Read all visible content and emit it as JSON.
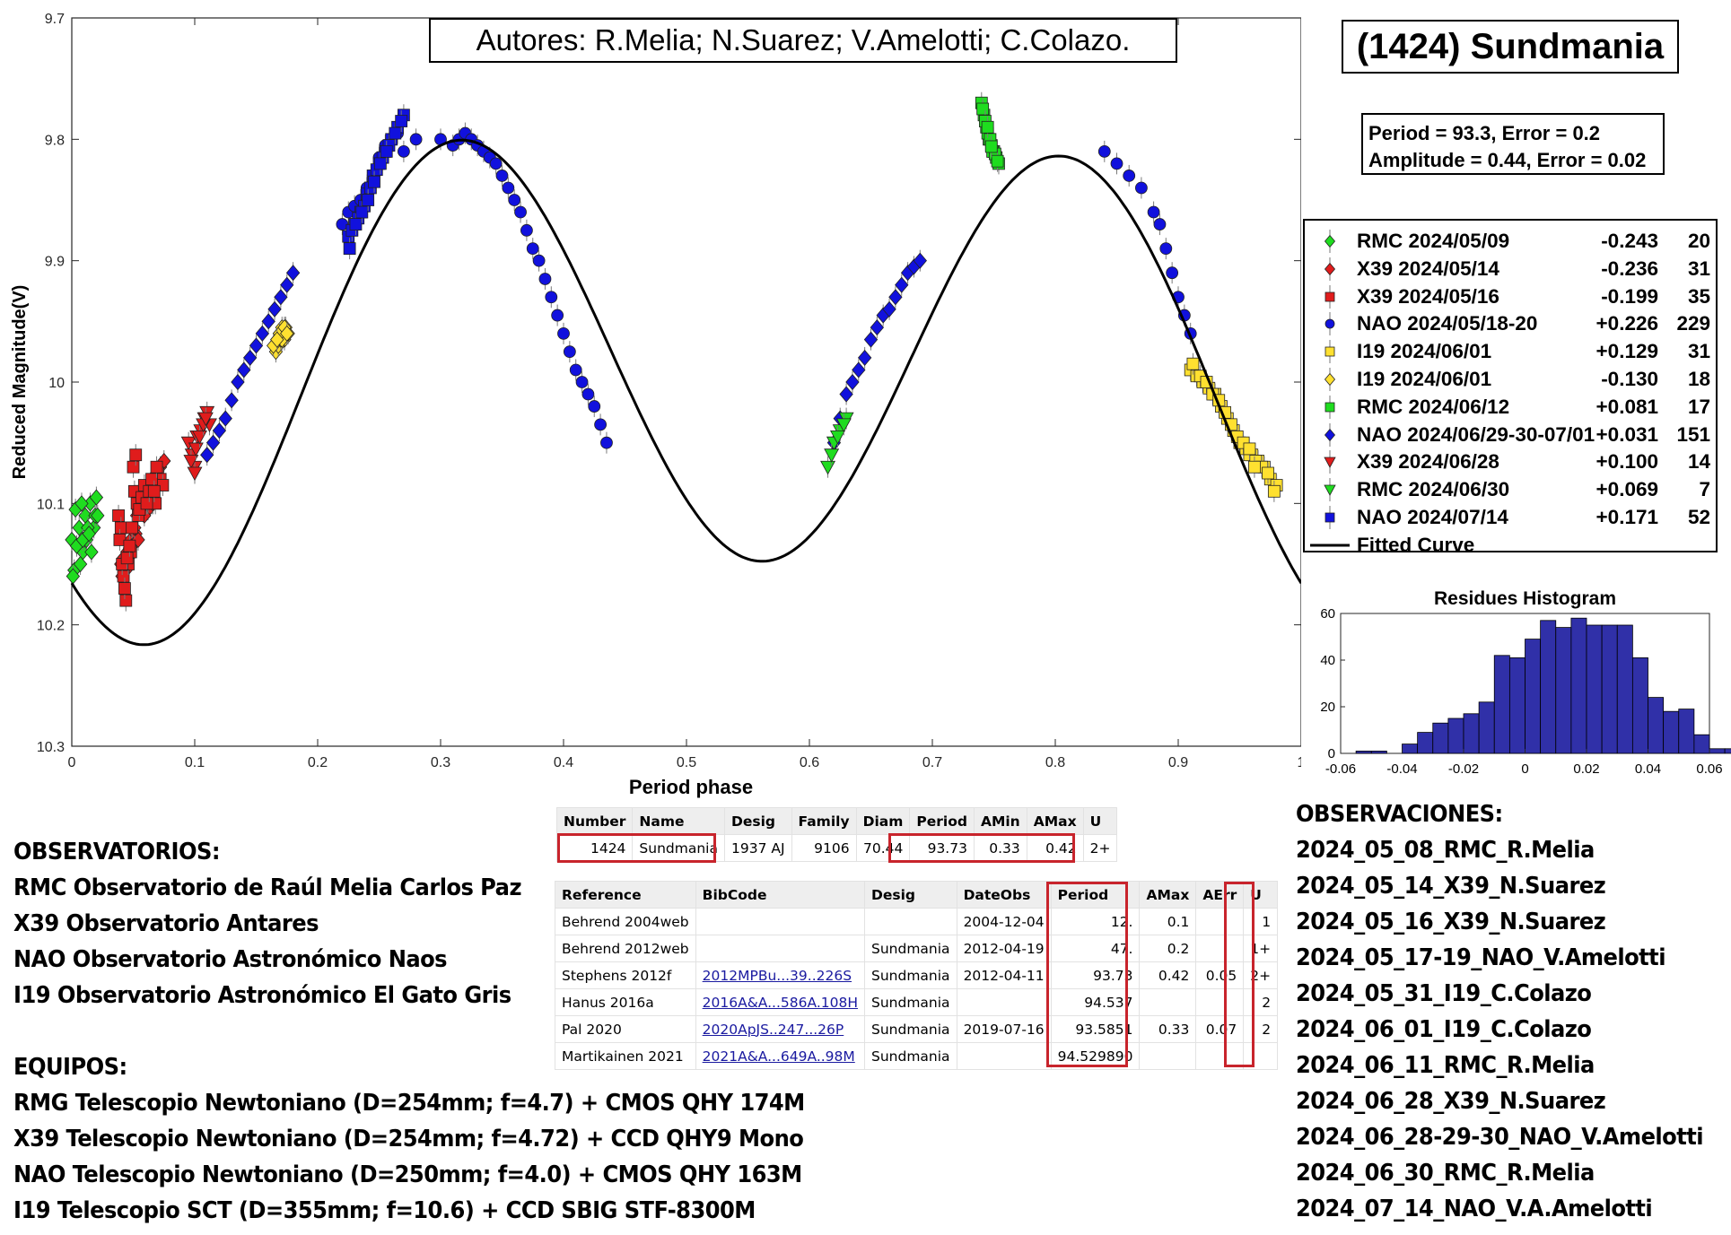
{
  "authors": "Autores: R.Melia; N.Suarez; V.Amelotti; C.Colazo.",
  "object_title": "(1424) Sundmania",
  "fit": {
    "period_line": "Period =  93.3, Error = 0.2",
    "amplitude_line": "Amplitude = 0.44, Error = 0.02"
  },
  "chart_data": [
    {
      "type": "scatter",
      "title": "",
      "xlabel": "Period phase",
      "ylabel": "Reduced Magnitude(V)",
      "xlim": [
        0,
        1
      ],
      "ylim": [
        10.3,
        9.7
      ],
      "y_inverted": true,
      "xticks": [
        "0",
        "0.1",
        "0.2",
        "0.3",
        "0.4",
        "0.5",
        "0.6",
        "0.7",
        "0.8",
        "0.9",
        "1"
      ],
      "yticks": [
        "9.7",
        "9.8",
        "9.9",
        "10",
        "10.1",
        "10.2",
        "10.3"
      ],
      "series": [
        {
          "name": "RMC 2024/05/09",
          "offset": "-0.243",
          "n": "20",
          "color": "#1fdc1f",
          "marker": "diamond",
          "x": [
            0.0,
            0.003,
            0.006,
            0.009,
            0.012,
            0.015,
            0.018,
            0.02,
            0.002,
            0.007,
            0.011,
            0.016,
            0.004,
            0.013,
            0.009,
            0.019,
            0.001,
            0.008,
            0.014,
            0.021
          ],
          "y": [
            10.13,
            10.105,
            10.12,
            10.14,
            10.13,
            10.1,
            10.12,
            10.095,
            10.155,
            10.15,
            10.11,
            10.14,
            10.135,
            10.12,
            10.13,
            10.11,
            10.16,
            10.1,
            10.125,
            10.11
          ]
        },
        {
          "name": "X39 2024/05/14",
          "offset": "-0.236",
          "n": "31",
          "color": "#e01c1c",
          "marker": "diamond",
          "x": [
            0.04,
            0.042,
            0.045,
            0.048,
            0.05,
            0.053,
            0.055,
            0.058,
            0.06,
            0.063,
            0.065,
            0.068,
            0.07,
            0.043,
            0.047,
            0.052,
            0.057,
            0.062,
            0.066,
            0.072,
            0.075,
            0.044,
            0.049,
            0.054,
            0.059,
            0.064,
            0.069,
            0.041,
            0.046,
            0.051,
            0.061
          ],
          "y": [
            10.15,
            10.145,
            10.14,
            10.13,
            10.12,
            10.11,
            10.1,
            10.105,
            10.1,
            10.09,
            10.1,
            10.085,
            10.08,
            10.15,
            10.14,
            10.125,
            10.095,
            10.105,
            10.1,
            10.07,
            10.065,
            10.155,
            10.135,
            10.13,
            10.11,
            10.09,
            10.075,
            10.16,
            10.145,
            10.12,
            10.1
          ]
        },
        {
          "name": "X39 2024/05/16",
          "offset": "-0.199",
          "n": "35",
          "color": "#e01c1c",
          "marker": "square",
          "x": [
            0.038,
            0.04,
            0.042,
            0.044,
            0.046,
            0.048,
            0.05,
            0.052,
            0.054,
            0.056,
            0.058,
            0.06,
            0.062,
            0.064,
            0.066,
            0.068,
            0.07,
            0.072,
            0.074,
            0.039,
            0.041,
            0.043,
            0.045,
            0.047,
            0.049,
            0.051,
            0.053,
            0.055,
            0.057,
            0.059,
            0.061,
            0.063,
            0.065,
            0.067,
            0.069
          ],
          "y": [
            10.11,
            10.12,
            10.16,
            10.18,
            10.15,
            10.14,
            10.07,
            10.06,
            10.11,
            10.09,
            10.1,
            10.09,
            10.1,
            10.095,
            10.085,
            10.1,
            10.075,
            10.08,
            10.085,
            10.13,
            10.15,
            10.17,
            10.145,
            10.135,
            10.12,
            10.09,
            10.1,
            10.105,
            10.095,
            10.085,
            10.1,
            10.09,
            10.08,
            10.09,
            10.07
          ]
        },
        {
          "name": "NAO 2024/05/18-20",
          "offset": "+0.226",
          "n": "229",
          "color": "#1111dd",
          "marker": "circle",
          "x": [
            0.27,
            0.28,
            0.3,
            0.31,
            0.315,
            0.32,
            0.325,
            0.33,
            0.335,
            0.34,
            0.345,
            0.35,
            0.355,
            0.36,
            0.365,
            0.37,
            0.375,
            0.38,
            0.385,
            0.39,
            0.395,
            0.4,
            0.405,
            0.41,
            0.415,
            0.42,
            0.425,
            0.43,
            0.435,
            0.22,
            0.225,
            0.23,
            0.235,
            0.24,
            0.245,
            0.25,
            0.255,
            0.26,
            0.265,
            0.84,
            0.85,
            0.86,
            0.87,
            0.88,
            0.885,
            0.89,
            0.895,
            0.9,
            0.905,
            0.91
          ],
          "y": [
            9.81,
            9.8,
            9.8,
            9.805,
            9.8,
            9.795,
            9.8,
            9.805,
            9.81,
            9.815,
            9.82,
            9.83,
            9.84,
            9.85,
            9.86,
            9.875,
            9.89,
            9.9,
            9.915,
            9.93,
            9.945,
            9.96,
            9.975,
            9.99,
            10.0,
            10.01,
            10.02,
            10.035,
            10.05,
            9.87,
            9.86,
            9.855,
            9.85,
            9.84,
            9.83,
            9.815,
            9.805,
            9.8,
            9.795,
            9.81,
            9.82,
            9.83,
            9.84,
            9.86,
            9.87,
            9.89,
            9.91,
            9.93,
            9.945,
            9.96
          ]
        },
        {
          "name": "I19 2024/06/01",
          "offset": "+0.129",
          "n": "31",
          "color": "#ffe030",
          "marker": "square",
          "x": [
            0.91,
            0.915,
            0.92,
            0.925,
            0.93,
            0.935,
            0.94,
            0.945,
            0.95,
            0.955,
            0.96,
            0.965,
            0.97,
            0.975,
            0.98,
            0.912,
            0.918,
            0.923,
            0.928,
            0.933,
            0.938,
            0.943,
            0.948,
            0.953,
            0.958,
            0.963,
            0.968,
            0.973,
            0.978,
            0.958,
            0.962
          ],
          "y": [
            9.99,
            9.995,
            10.0,
            10.005,
            10.01,
            10.02,
            10.03,
            10.04,
            10.05,
            10.055,
            10.06,
            10.065,
            10.07,
            10.08,
            10.085,
            9.985,
            9.995,
            10.0,
            10.01,
            10.015,
            10.025,
            10.035,
            10.045,
            10.05,
            10.06,
            10.065,
            10.07,
            10.075,
            10.09,
            10.055,
            10.07
          ]
        },
        {
          "name": "I19 2024/06/01",
          "offset": "-0.130",
          "n": "18",
          "color": "#ffe030",
          "marker": "diamond",
          "x": [
            0.165,
            0.167,
            0.169,
            0.171,
            0.173,
            0.175,
            0.166,
            0.168,
            0.17,
            0.172,
            0.174,
            0.176,
            0.164,
            0.171,
            0.169,
            0.173,
            0.167,
            0.175
          ],
          "y": [
            9.97,
            9.965,
            9.96,
            9.955,
            9.965,
            9.96,
            9.975,
            9.97,
            9.965,
            9.96,
            9.955,
            9.96,
            9.97,
            9.965,
            9.96,
            9.955,
            9.965,
            9.96
          ]
        },
        {
          "name": "RMC 2024/06/12",
          "offset": "+0.081",
          "n": "17",
          "color": "#1fdc1f",
          "marker": "square",
          "x": [
            0.74,
            0.742,
            0.744,
            0.746,
            0.748,
            0.75,
            0.752,
            0.754,
            0.741,
            0.743,
            0.745,
            0.747,
            0.749,
            0.751,
            0.753,
            0.745,
            0.748
          ],
          "y": [
            9.77,
            9.78,
            9.79,
            9.8,
            9.805,
            9.81,
            9.815,
            9.82,
            9.775,
            9.785,
            9.795,
            9.8,
            9.81,
            9.812,
            9.818,
            9.79,
            9.806
          ]
        },
        {
          "name": "NAO 2024/06/29-30-07/01",
          "offset": "+0.031",
          "n": "151",
          "color": "#1111dd",
          "marker": "diamond",
          "x": [
            0.12,
            0.125,
            0.13,
            0.135,
            0.14,
            0.145,
            0.15,
            0.155,
            0.16,
            0.165,
            0.17,
            0.175,
            0.18,
            0.62,
            0.625,
            0.63,
            0.635,
            0.64,
            0.645,
            0.65,
            0.655,
            0.66,
            0.665,
            0.67,
            0.675,
            0.68,
            0.685,
            0.69,
            0.11,
            0.115
          ],
          "y": [
            10.04,
            10.03,
            10.015,
            10.0,
            9.99,
            9.98,
            9.97,
            9.96,
            9.95,
            9.94,
            9.93,
            9.92,
            9.91,
            10.05,
            10.03,
            10.01,
            10.0,
            9.99,
            9.98,
            9.965,
            9.955,
            9.945,
            9.94,
            9.93,
            9.92,
            9.91,
            9.905,
            9.9,
            10.06,
            10.05
          ]
        },
        {
          "name": "X39 2024/06/28",
          "offset": "+0.100",
          "n": "14",
          "color": "#e01c1c",
          "marker": "triangle-down",
          "x": [
            0.095,
            0.098,
            0.1,
            0.102,
            0.105,
            0.108,
            0.11,
            0.112,
            0.097,
            0.101,
            0.104,
            0.107,
            0.109,
            0.1
          ],
          "y": [
            10.05,
            10.06,
            10.07,
            10.045,
            10.04,
            10.03,
            10.025,
            10.035,
            10.065,
            10.055,
            10.045,
            10.035,
            10.03,
            10.075
          ]
        },
        {
          "name": "RMC 2024/06/30",
          "offset": "+0.069",
          "n": "7",
          "color": "#1fdc1f",
          "marker": "triangle-down",
          "x": [
            0.615,
            0.62,
            0.625,
            0.63,
            0.618,
            0.623,
            0.628
          ],
          "y": [
            10.07,
            10.05,
            10.04,
            10.03,
            10.06,
            10.045,
            10.035
          ]
        },
        {
          "name": "NAO 2024/07/14",
          "offset": "+0.171",
          "n": "52",
          "color": "#1111dd",
          "marker": "square",
          "x": [
            0.225,
            0.23,
            0.235,
            0.24,
            0.245,
            0.25,
            0.255,
            0.26,
            0.265,
            0.27,
            0.228,
            0.233,
            0.238,
            0.243,
            0.248,
            0.253,
            0.258,
            0.263,
            0.268,
            0.226,
            0.231,
            0.236,
            0.241,
            0.246,
            0.251,
            0.256
          ],
          "y": [
            9.88,
            9.87,
            9.86,
            9.845,
            9.83,
            9.82,
            9.81,
            9.8,
            9.79,
            9.78,
            9.875,
            9.865,
            9.855,
            9.84,
            9.825,
            9.815,
            9.805,
            9.795,
            9.785,
            9.89,
            9.87,
            9.86,
            9.85,
            9.835,
            9.82,
            9.81
          ]
        }
      ],
      "fitted_curve": {
        "name": "Fitted Curve",
        "color": "#000000"
      }
    },
    {
      "type": "bar",
      "title": "Residues Histogram",
      "xlim": [
        -0.06,
        0.06
      ],
      "ylim": [
        0,
        60
      ],
      "xticks": [
        "-0.06",
        "-0.04",
        "-0.02",
        "0",
        "0.02",
        "0.04",
        "0.06"
      ],
      "yticks": [
        "0",
        "20",
        "40",
        "60"
      ],
      "bin_width": 0.005,
      "bin_left": -0.06,
      "values": [
        0,
        1,
        1,
        0,
        4,
        9,
        13,
        15,
        17,
        22,
        42,
        41,
        49,
        57,
        54,
        58,
        55,
        55,
        55,
        41,
        24,
        18,
        19,
        8,
        2,
        2,
        2,
        0
      ],
      "bar_color": "#3030a8"
    }
  ],
  "summary_table": {
    "headers": [
      "Number",
      "Name",
      "Desig",
      "Family",
      "Diam",
      "Period",
      "AMin",
      "AMax",
      "U"
    ],
    "row": [
      "1424",
      "Sundmania",
      "1937 AJ",
      "9106",
      "70.44",
      "93.73",
      "0.33",
      "0.42",
      "2+"
    ]
  },
  "references_table": {
    "headers": [
      "Reference",
      "BibCode",
      "Desig",
      "DateObs",
      "Period",
      "AMax",
      "AErr",
      "U"
    ],
    "rows": [
      [
        "Behrend 2004web",
        "",
        "",
        "2004-12-04",
        "12.",
        "0.1",
        "",
        "1"
      ],
      [
        "Behrend 2012web",
        "",
        "Sundmania",
        "2012-04-19",
        "47.",
        "0.2",
        "",
        "1+"
      ],
      [
        "Stephens 2012f",
        "2012MPBu...39..226S",
        "Sundmania",
        "2012-04-11",
        "93.73",
        "0.42",
        "0.05",
        "2+"
      ],
      [
        "Hanus 2016a",
        "2016A&A...586A.108H",
        "Sundmania",
        "",
        "94.537",
        "",
        "",
        "2"
      ],
      [
        "Pal 2020",
        "2020ApJS..247...26P",
        "Sundmania",
        "2019-07-16",
        "93.5851",
        "0.33",
        "0.07",
        "2"
      ],
      [
        "Martikainen 2021",
        "2021A&A...649A..98M",
        "Sundmania",
        "",
        "94.529890",
        "",
        "",
        ""
      ]
    ]
  },
  "observatories": {
    "heading": "OBSERVATORIOS:",
    "items": [
      "RMC Observatorio de Raúl Melia Carlos Paz",
      "X39 Observatorio Antares",
      "NAO Observatorio Astronómico Naos",
      "I19 Observatorio Astronómico El Gato Gris"
    ]
  },
  "equipment": {
    "heading": "EQUIPOS:",
    "items": [
      "RMG Telescopio Newtoniano (D=254mm; f=4.7) + CMOS QHY 174M",
      "X39 Telescopio Newtoniano (D=254mm; f=4.72) + CCD QHY9 Mono",
      "NAO Telescopio Newtoniano (D=250mm; f=4.0) + CMOS QHY 163M",
      "I19 Telescopio SCT (D=355mm; f=10.6) + CCD SBIG STF-8300M"
    ]
  },
  "observations": {
    "heading": "OBSERVACIONES:",
    "items": [
      "2024_05_08_RMC_R.Melia",
      "2024_05_14_X39_N.Suarez",
      "2024_05_16_X39_N.Suarez",
      "2024_05_17-19_NAO_V.Amelotti",
      "2024_05_31_I19_C.Colazo",
      "2024_06_01_I19_C.Colazo",
      "2024_06_11_RMC_R.Melia",
      "2024_06_28_X39_N.Suarez",
      "2024_06_28-29-30_NAO_V.Amelotti",
      "2024_06_30_RMC_R.Melia",
      "2024_07_14_NAO_V.A.Amelotti"
    ]
  }
}
